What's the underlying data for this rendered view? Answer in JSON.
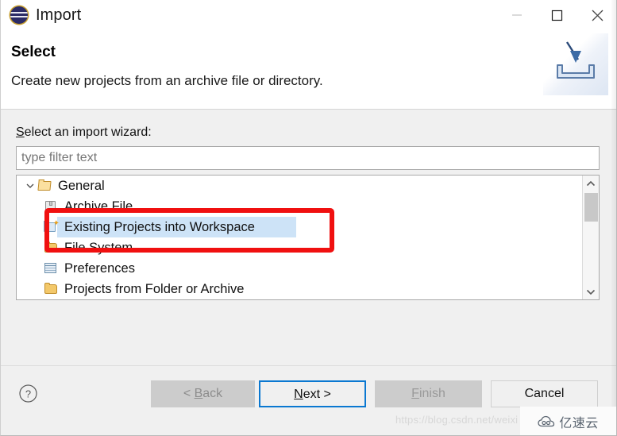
{
  "window": {
    "title": "Import",
    "icon": "eclipse-icon",
    "controls": {
      "minimize": "minimize-icon",
      "maximize": "maximize-icon",
      "close": "close-icon"
    }
  },
  "header": {
    "title": "Select",
    "description": "Create new projects from an archive file or directory.",
    "banner_icon": "import-banner-icon"
  },
  "body": {
    "field_label_prefix": "S",
    "field_label_rest": "elect an import wizard:",
    "filter": {
      "value": "",
      "placeholder": "type filter text"
    },
    "tree": [
      {
        "label": "General",
        "icon": "folder-open-icon",
        "level": 0,
        "expanded": true,
        "selected": false
      },
      {
        "label": "Archive File",
        "icon": "archive-file-icon",
        "level": 1,
        "selected": false
      },
      {
        "label": "Existing Projects into Workspace",
        "icon": "project-import-icon",
        "level": 1,
        "selected": true
      },
      {
        "label": "File System",
        "icon": "folder-icon",
        "level": 1,
        "selected": false
      },
      {
        "label": "Preferences",
        "icon": "preferences-icon",
        "level": 1,
        "selected": false
      },
      {
        "label": "Projects from Folder or Archive",
        "icon": "folder-icon",
        "level": 1,
        "selected": false
      }
    ],
    "scrollbar": {
      "up": "chevron-up-icon",
      "down": "chevron-down-icon"
    },
    "annotation": {
      "type": "red-rectangle",
      "color": "#f01010"
    }
  },
  "footer": {
    "help": "help-icon",
    "buttons": {
      "back": {
        "prefix": "< ",
        "mnemonic": "B",
        "rest": "ack",
        "enabled": false
      },
      "next": {
        "mnemonic": "N",
        "rest": "ext >",
        "enabled": true,
        "focused": true
      },
      "finish": {
        "mnemonic": "F",
        "rest": "inish",
        "enabled": false
      },
      "cancel": {
        "label": "Cancel",
        "enabled": true
      }
    }
  },
  "watermark": {
    "url": "https://blog.csdn.net/weixi",
    "logo_text": "亿速云",
    "logo_icon": "cloud-icon"
  },
  "colors": {
    "accent": "#0a78d1",
    "selection": "#cde3f7",
    "annotation": "#f01010",
    "dialog_bg": "#f0f0f0"
  }
}
